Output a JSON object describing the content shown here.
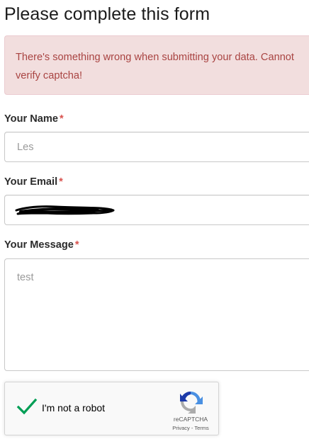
{
  "form": {
    "title": "Please complete this form",
    "error_message": "There's something wrong when submitting your data. Cannot verify captcha!",
    "required_marker": "*",
    "name_label": "Your Name",
    "name_value": "Les",
    "email_label": "Your Email",
    "email_value": "",
    "message_label": "Your Message",
    "message_value": "test"
  },
  "recaptcha": {
    "checkbox_state": "checked",
    "label": "I'm not a robot",
    "brand": "reCAPTCHA",
    "privacy_link": "Privacy",
    "separator": " - ",
    "terms_link": "Terms"
  },
  "colors": {
    "alert_background": "#f2dede",
    "alert_text": "#a94442",
    "required_marker": "#d9534f",
    "check_green": "#009e55"
  }
}
